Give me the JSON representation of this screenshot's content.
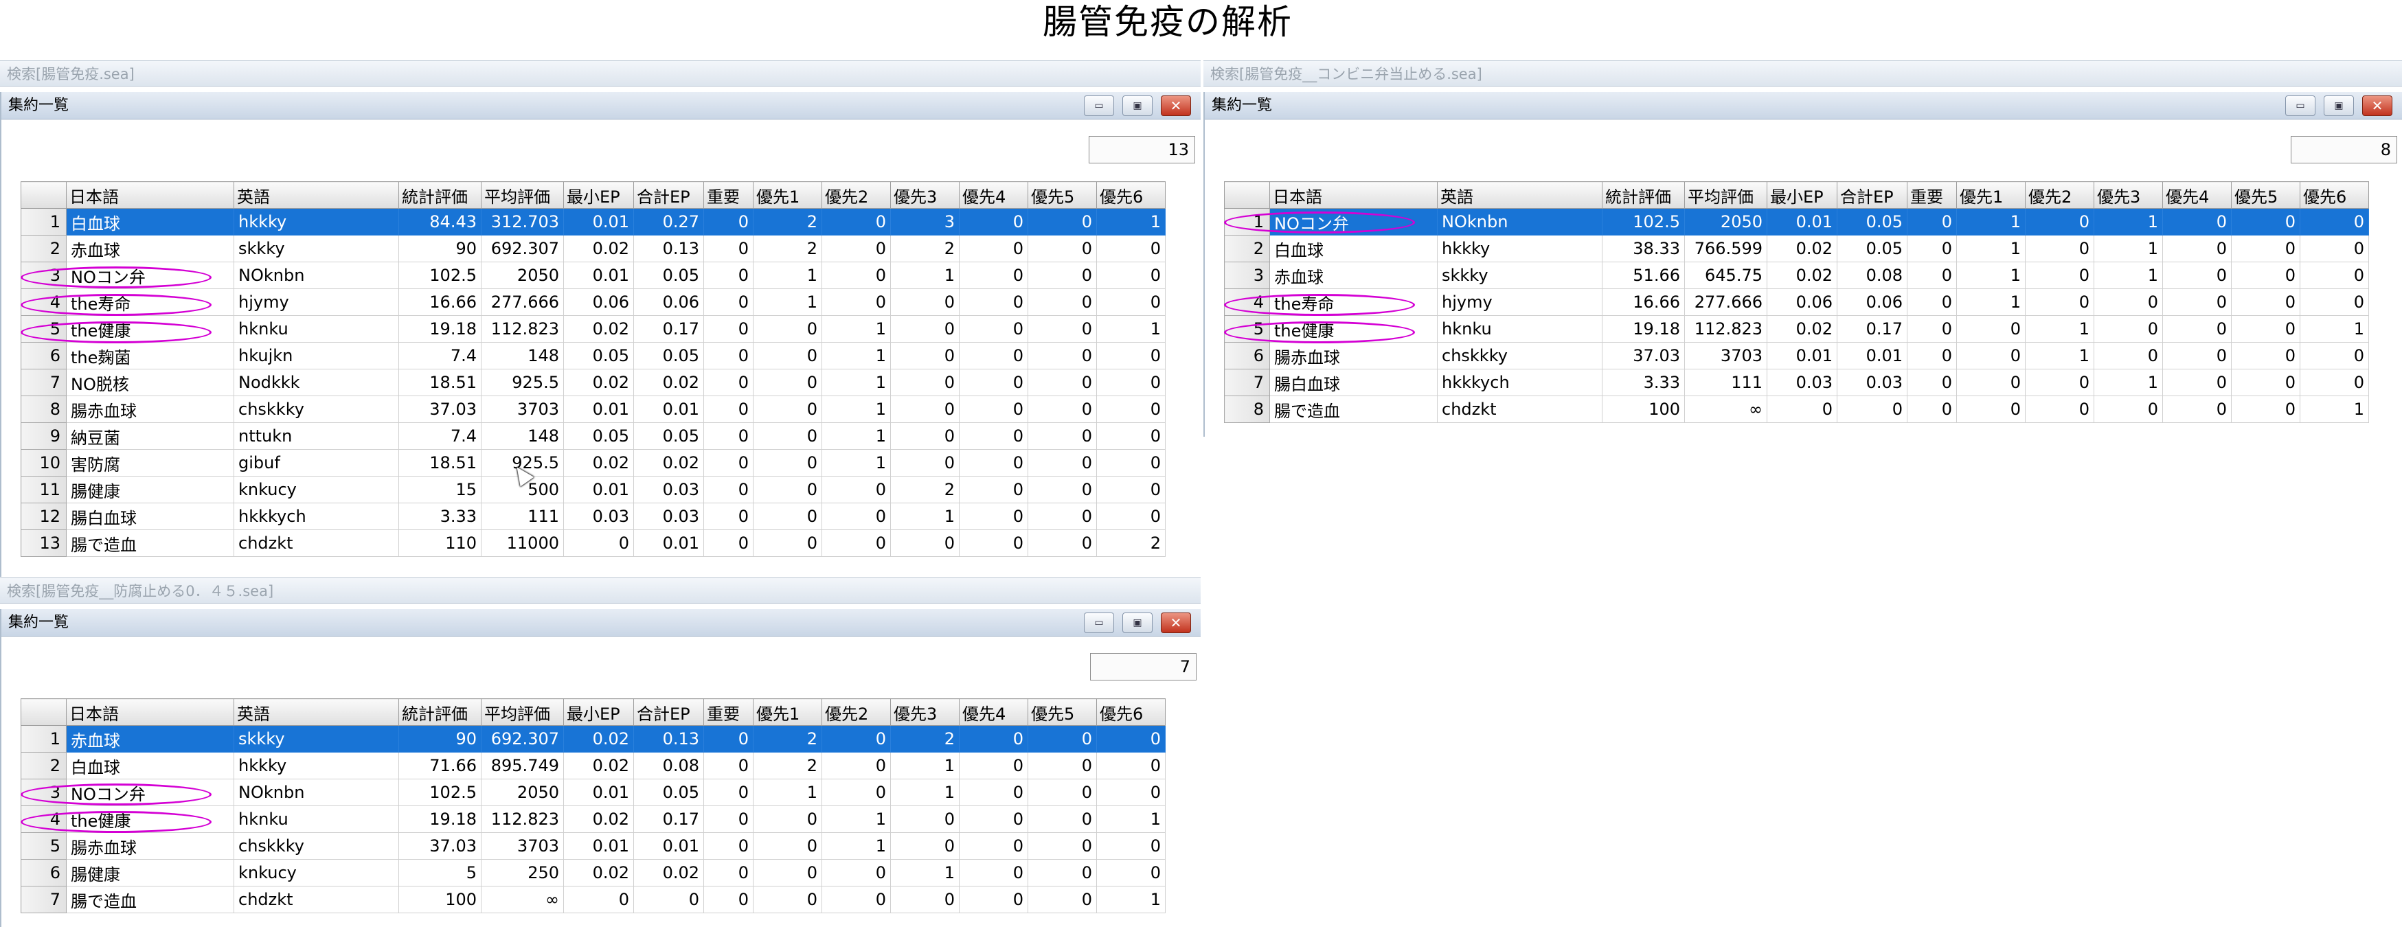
{
  "title": "腸管免疫の解析",
  "columns": [
    "",
    "日本語",
    "英語",
    "統計評価",
    "平均評価",
    "最小EP",
    "合計EP",
    "重要",
    "優先1",
    "優先2",
    "優先3",
    "優先4",
    "優先5",
    "優先6"
  ],
  "window_controls": {
    "minimize": "▭",
    "maximize": "▣",
    "close": "✕"
  },
  "colors": {
    "selection": "#1874d6",
    "annotation": "#d400d4"
  },
  "panels": [
    {
      "outer_title": "検索[腸管免疫.sea]",
      "inner_title": "集約一覧",
      "count": "13",
      "selected_row": 0,
      "circled_rows": [
        2,
        3,
        4
      ],
      "rows": [
        [
          "1",
          "白血球",
          "hkkky",
          "84.43",
          "312.703",
          "0.01",
          "0.27",
          "0",
          "2",
          "0",
          "3",
          "0",
          "0",
          "1"
        ],
        [
          "2",
          "赤血球",
          "skkky",
          "90",
          "692.307",
          "0.02",
          "0.13",
          "0",
          "2",
          "0",
          "2",
          "0",
          "0",
          "0"
        ],
        [
          "3",
          "NOコン弁",
          "NOknbn",
          "102.5",
          "2050",
          "0.01",
          "0.05",
          "0",
          "1",
          "0",
          "1",
          "0",
          "0",
          "0"
        ],
        [
          "4",
          "the寿命",
          "hjymy",
          "16.66",
          "277.666",
          "0.06",
          "0.06",
          "0",
          "1",
          "0",
          "0",
          "0",
          "0",
          "0"
        ],
        [
          "5",
          "the健康",
          "hknku",
          "19.18",
          "112.823",
          "0.02",
          "0.17",
          "0",
          "0",
          "1",
          "0",
          "0",
          "0",
          "1"
        ],
        [
          "6",
          "the麹菌",
          "hkujkn",
          "7.4",
          "148",
          "0.05",
          "0.05",
          "0",
          "0",
          "1",
          "0",
          "0",
          "0",
          "0"
        ],
        [
          "7",
          "NO脱核",
          "Nodkkk",
          "18.51",
          "925.5",
          "0.02",
          "0.02",
          "0",
          "0",
          "1",
          "0",
          "0",
          "0",
          "0"
        ],
        [
          "8",
          "腸赤血球",
          "chskkky",
          "37.03",
          "3703",
          "0.01",
          "0.01",
          "0",
          "0",
          "1",
          "0",
          "0",
          "0",
          "0"
        ],
        [
          "9",
          "納豆菌",
          "nttukn",
          "7.4",
          "148",
          "0.05",
          "0.05",
          "0",
          "0",
          "1",
          "0",
          "0",
          "0",
          "0"
        ],
        [
          "10",
          "害防腐",
          "gibuf",
          "18.51",
          "925.5",
          "0.02",
          "0.02",
          "0",
          "0",
          "1",
          "0",
          "0",
          "0",
          "0"
        ],
        [
          "11",
          "腸健康",
          "knkucy",
          "15",
          "500",
          "0.01",
          "0.03",
          "0",
          "0",
          "0",
          "2",
          "0",
          "0",
          "0"
        ],
        [
          "12",
          "腸白血球",
          "hkkkych",
          "3.33",
          "111",
          "0.03",
          "0.03",
          "0",
          "0",
          "0",
          "1",
          "0",
          "0",
          "0"
        ],
        [
          "13",
          "腸で造血",
          "chdzkt",
          "110",
          "11000",
          "0",
          "0.01",
          "0",
          "0",
          "0",
          "0",
          "0",
          "0",
          "2"
        ]
      ]
    },
    {
      "outer_title": "検索[腸管免疫__コンビニ弁当止める.sea]",
      "inner_title": "集約一覧",
      "count": "8",
      "selected_row": 0,
      "circled_rows": [
        0,
        3,
        4
      ],
      "rows": [
        [
          "1",
          "NOコン弁",
          "NOknbn",
          "102.5",
          "2050",
          "0.01",
          "0.05",
          "0",
          "1",
          "0",
          "1",
          "0",
          "0",
          "0"
        ],
        [
          "2",
          "白血球",
          "hkkky",
          "38.33",
          "766.599",
          "0.02",
          "0.05",
          "0",
          "1",
          "0",
          "1",
          "0",
          "0",
          "0"
        ],
        [
          "3",
          "赤血球",
          "skkky",
          "51.66",
          "645.75",
          "0.02",
          "0.08",
          "0",
          "1",
          "0",
          "1",
          "0",
          "0",
          "0"
        ],
        [
          "4",
          "the寿命",
          "hjymy",
          "16.66",
          "277.666",
          "0.06",
          "0.06",
          "0",
          "1",
          "0",
          "0",
          "0",
          "0",
          "0"
        ],
        [
          "5",
          "the健康",
          "hknku",
          "19.18",
          "112.823",
          "0.02",
          "0.17",
          "0",
          "0",
          "1",
          "0",
          "0",
          "0",
          "1"
        ],
        [
          "6",
          "腸赤血球",
          "chskkky",
          "37.03",
          "3703",
          "0.01",
          "0.01",
          "0",
          "0",
          "1",
          "0",
          "0",
          "0",
          "0"
        ],
        [
          "7",
          "腸白血球",
          "hkkkych",
          "3.33",
          "111",
          "0.03",
          "0.03",
          "0",
          "0",
          "0",
          "1",
          "0",
          "0",
          "0"
        ],
        [
          "8",
          "腸で造血",
          "chdzkt",
          "100",
          "∞",
          "0",
          "0",
          "0",
          "0",
          "0",
          "0",
          "0",
          "0",
          "1"
        ]
      ]
    },
    {
      "outer_title": "検索[腸管免疫__防腐止める0．４５.sea]",
      "inner_title": "集約一覧",
      "count": "7",
      "selected_row": 0,
      "circled_rows": [
        2,
        3
      ],
      "rows": [
        [
          "1",
          "赤血球",
          "skkky",
          "90",
          "692.307",
          "0.02",
          "0.13",
          "0",
          "2",
          "0",
          "2",
          "0",
          "0",
          "0"
        ],
        [
          "2",
          "白血球",
          "hkkky",
          "71.66",
          "895.749",
          "0.02",
          "0.08",
          "0",
          "2",
          "0",
          "1",
          "0",
          "0",
          "0"
        ],
        [
          "3",
          "NOコン弁",
          "NOknbn",
          "102.5",
          "2050",
          "0.01",
          "0.05",
          "0",
          "1",
          "0",
          "1",
          "0",
          "0",
          "0"
        ],
        [
          "4",
          "the健康",
          "hknku",
          "19.18",
          "112.823",
          "0.02",
          "0.17",
          "0",
          "0",
          "1",
          "0",
          "0",
          "0",
          "1"
        ],
        [
          "5",
          "腸赤血球",
          "chskkky",
          "37.03",
          "3703",
          "0.01",
          "0.01",
          "0",
          "0",
          "1",
          "0",
          "0",
          "0",
          "0"
        ],
        [
          "6",
          "腸健康",
          "knkucy",
          "5",
          "250",
          "0.02",
          "0.02",
          "0",
          "0",
          "0",
          "1",
          "0",
          "0",
          "0"
        ],
        [
          "7",
          "腸で造血",
          "chdzkt",
          "100",
          "∞",
          "0",
          "0",
          "0",
          "0",
          "0",
          "0",
          "0",
          "0",
          "1"
        ]
      ]
    }
  ]
}
